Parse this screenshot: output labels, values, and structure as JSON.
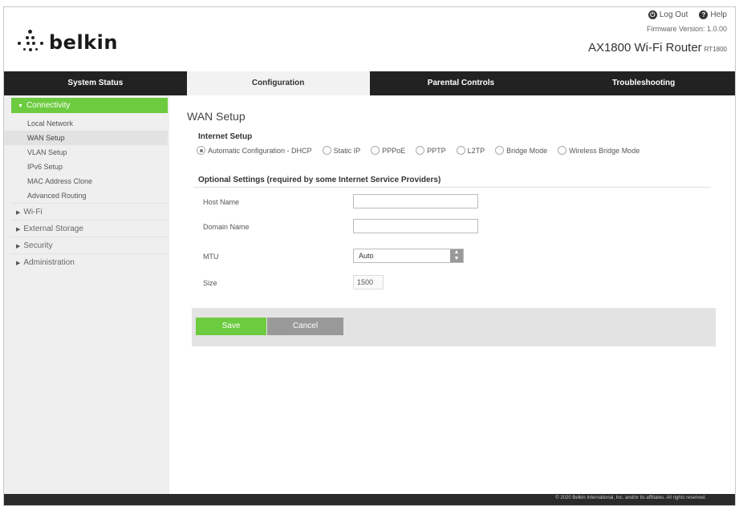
{
  "header": {
    "logo_text": "belkin",
    "logout_label": "Log Out",
    "help_label": "Help",
    "firmware": "Firmware Version: 1.0.00",
    "model": "AX1800 Wi-Fi Router",
    "model_code": "RT1800"
  },
  "tabs": [
    {
      "label": "System Status"
    },
    {
      "label": "Configuration",
      "active": true
    },
    {
      "label": "Parental Controls"
    },
    {
      "label": "Troubleshooting"
    }
  ],
  "sidebar": {
    "active_group": "Connectivity",
    "sub_items": [
      {
        "label": "Local Network"
      },
      {
        "label": "WAN Setup",
        "active": true
      },
      {
        "label": "VLAN Setup"
      },
      {
        "label": "IPv6 Setup"
      },
      {
        "label": "MAC Address Clone"
      },
      {
        "label": "Advanced Routing"
      }
    ],
    "groups": [
      {
        "label": "Wi-Fi"
      },
      {
        "label": "External Storage"
      },
      {
        "label": "Security"
      },
      {
        "label": "Administration"
      }
    ]
  },
  "main": {
    "title": "WAN Setup",
    "internet_setup_title": "Internet Setup",
    "connection_types": [
      {
        "label": "Automatic Configuration - DHCP",
        "selected": true
      },
      {
        "label": "Static IP"
      },
      {
        "label": "PPPoE"
      },
      {
        "label": "PPTP"
      },
      {
        "label": "L2TP"
      },
      {
        "label": "Bridge Mode"
      },
      {
        "label": "Wireless Bridge Mode"
      }
    ],
    "optional_title": "Optional Settings (required by some Internet Service Providers)",
    "host_name_label": "Host Name",
    "host_name_value": "",
    "domain_name_label": "Domain Name",
    "domain_name_value": "",
    "mtu_label": "MTU",
    "mtu_value": "Auto",
    "size_label": "Size",
    "size_value": "1500",
    "save_label": "Save",
    "cancel_label": "Cancel"
  },
  "footer": {
    "copyright": "© 2020 Belkin International, Inc. and/or its affiliates. All rights reserved."
  },
  "colors": {
    "accent": "#6ccb3f",
    "nav_bg": "#222222",
    "sidebar_bg": "#efefef"
  }
}
